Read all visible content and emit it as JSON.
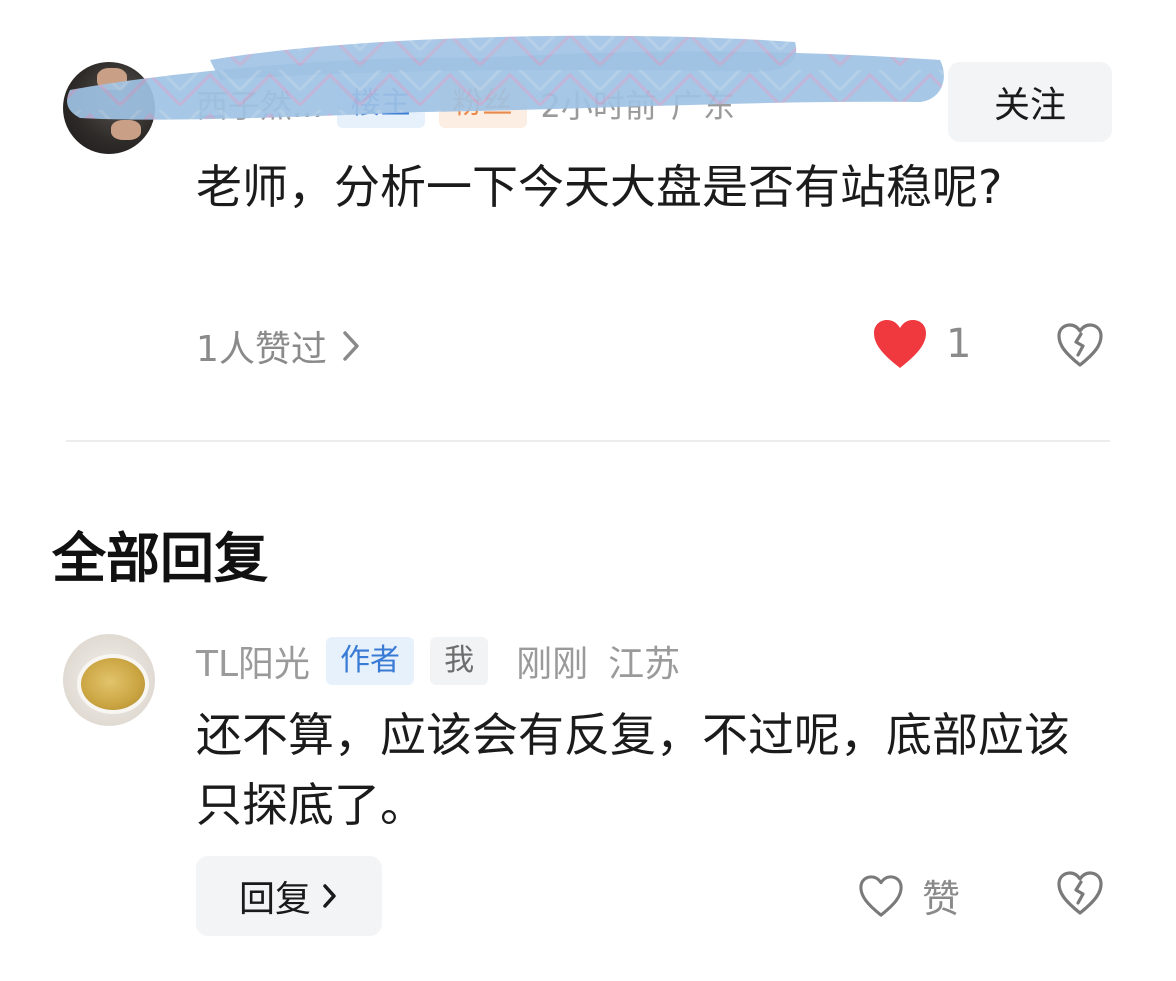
{
  "top_comment": {
    "username": "西子然...",
    "badges": [
      "楼主",
      "粉丝"
    ],
    "time": "2小时前",
    "location": "广东",
    "follow_label": "关注",
    "text": "老师，分析一下今天大盘是否有站稳呢?",
    "liked_by": "1人赞过",
    "like_count": "1",
    "liked": true,
    "colors": {
      "heart": "#f0383f",
      "author_badge": "#3a7bd5"
    }
  },
  "replies_section": {
    "title": "全部回复"
  },
  "reply": {
    "username": "TL阳光",
    "author_badge": "作者",
    "self_badge": "我",
    "time": "刚刚",
    "location": "江苏",
    "text": "还不算，应该会有反复，不过呢，底部应该只探底了。",
    "reply_label": "回复",
    "like_label": "赞"
  }
}
